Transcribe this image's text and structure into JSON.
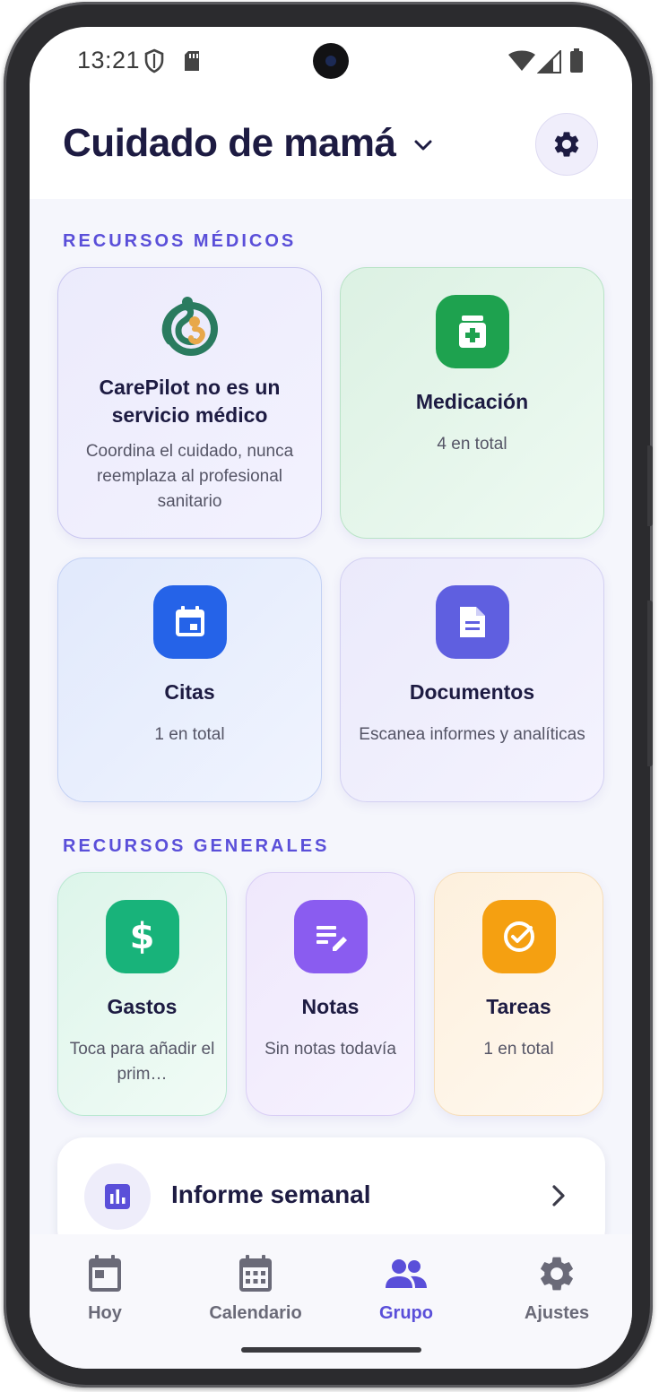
{
  "status_bar": {
    "time": "13:21"
  },
  "header": {
    "title": "Cuidado de mamá"
  },
  "sections": {
    "medical": "RECURSOS MÉDICOS",
    "general": "RECURSOS GENERALES"
  },
  "medical_cards": [
    {
      "title": "CarePilot no es un servicio médico",
      "subtitle": "Coordina el cuidado, nunca reemplaza al profesional sanitario"
    },
    {
      "title": "Medicación",
      "subtitle": "4 en total",
      "color": "#1ea24f"
    },
    {
      "title": "Citas",
      "subtitle": "1 en total",
      "color": "#2563e8"
    },
    {
      "title": "Documentos",
      "subtitle": "Escanea informes y analíticas",
      "color": "#5f5fe0"
    }
  ],
  "general_cards": [
    {
      "title": "Gastos",
      "subtitle": "Toca para añadir el prim…",
      "color": "#18b37a"
    },
    {
      "title": "Notas",
      "subtitle": "Sin notas todavía",
      "color": "#8a5cf0"
    },
    {
      "title": "Tareas",
      "subtitle": "1 en total",
      "color": "#f5a011"
    }
  ],
  "weekly_report": {
    "label": "Informe semanal"
  },
  "bottom_nav": [
    {
      "label": "Hoy",
      "icon": "calendar-today-icon"
    },
    {
      "label": "Calendario",
      "icon": "calendar-month-icon"
    },
    {
      "label": "Grupo",
      "icon": "group-icon",
      "active": true
    },
    {
      "label": "Ajustes",
      "icon": "gear-icon"
    }
  ],
  "colors": {
    "accent": "#5a4fd9",
    "title": "#1d1b42"
  }
}
